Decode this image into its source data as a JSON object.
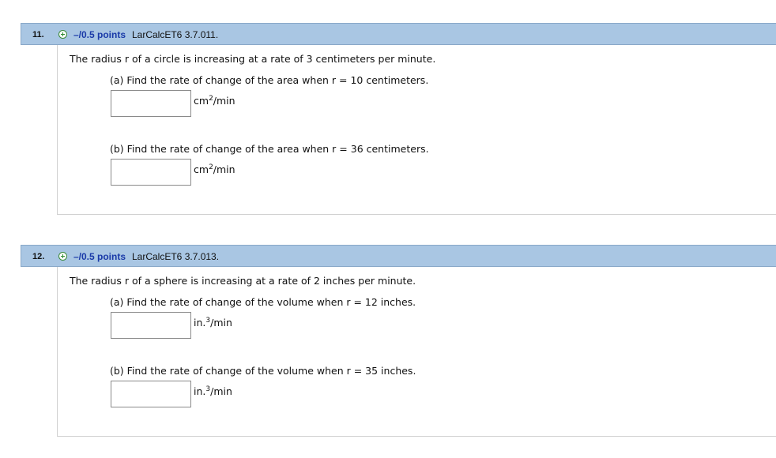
{
  "questions": [
    {
      "number": "11.",
      "points": "–/0.5 points",
      "source": "LarCalcET6 3.7.011.",
      "prompt": "The radius r of a circle is increasing at a rate of 3 centimeters per minute.",
      "parts": [
        {
          "label": "(a) Find the rate of change of the area when r = 10 centimeters.",
          "answer": "",
          "unit_base": "cm",
          "unit_exp": "2",
          "unit_tail": "/min"
        },
        {
          "label": "(b) Find the rate of change of the area when r = 36 centimeters.",
          "answer": "",
          "unit_base": "cm",
          "unit_exp": "2",
          "unit_tail": "/min"
        }
      ]
    },
    {
      "number": "12.",
      "points": "–/0.5 points",
      "source": "LarCalcET6 3.7.013.",
      "prompt": "The radius r of a sphere is increasing at a rate of 2 inches per minute.",
      "parts": [
        {
          "label": "(a)  Find the rate of change of the volume when r = 12 inches.",
          "answer": "",
          "unit_base": "in.",
          "unit_exp": "3",
          "unit_tail": "/min"
        },
        {
          "label": "(b)  Find the rate of change of the volume when r = 35 inches.",
          "answer": "",
          "unit_base": "in.",
          "unit_exp": "3",
          "unit_tail": "/min"
        }
      ]
    }
  ],
  "colors": {
    "header_bg": "#a9c6e3",
    "points_text": "#1a3aa8",
    "plus_icon": "#2e8b2e"
  }
}
